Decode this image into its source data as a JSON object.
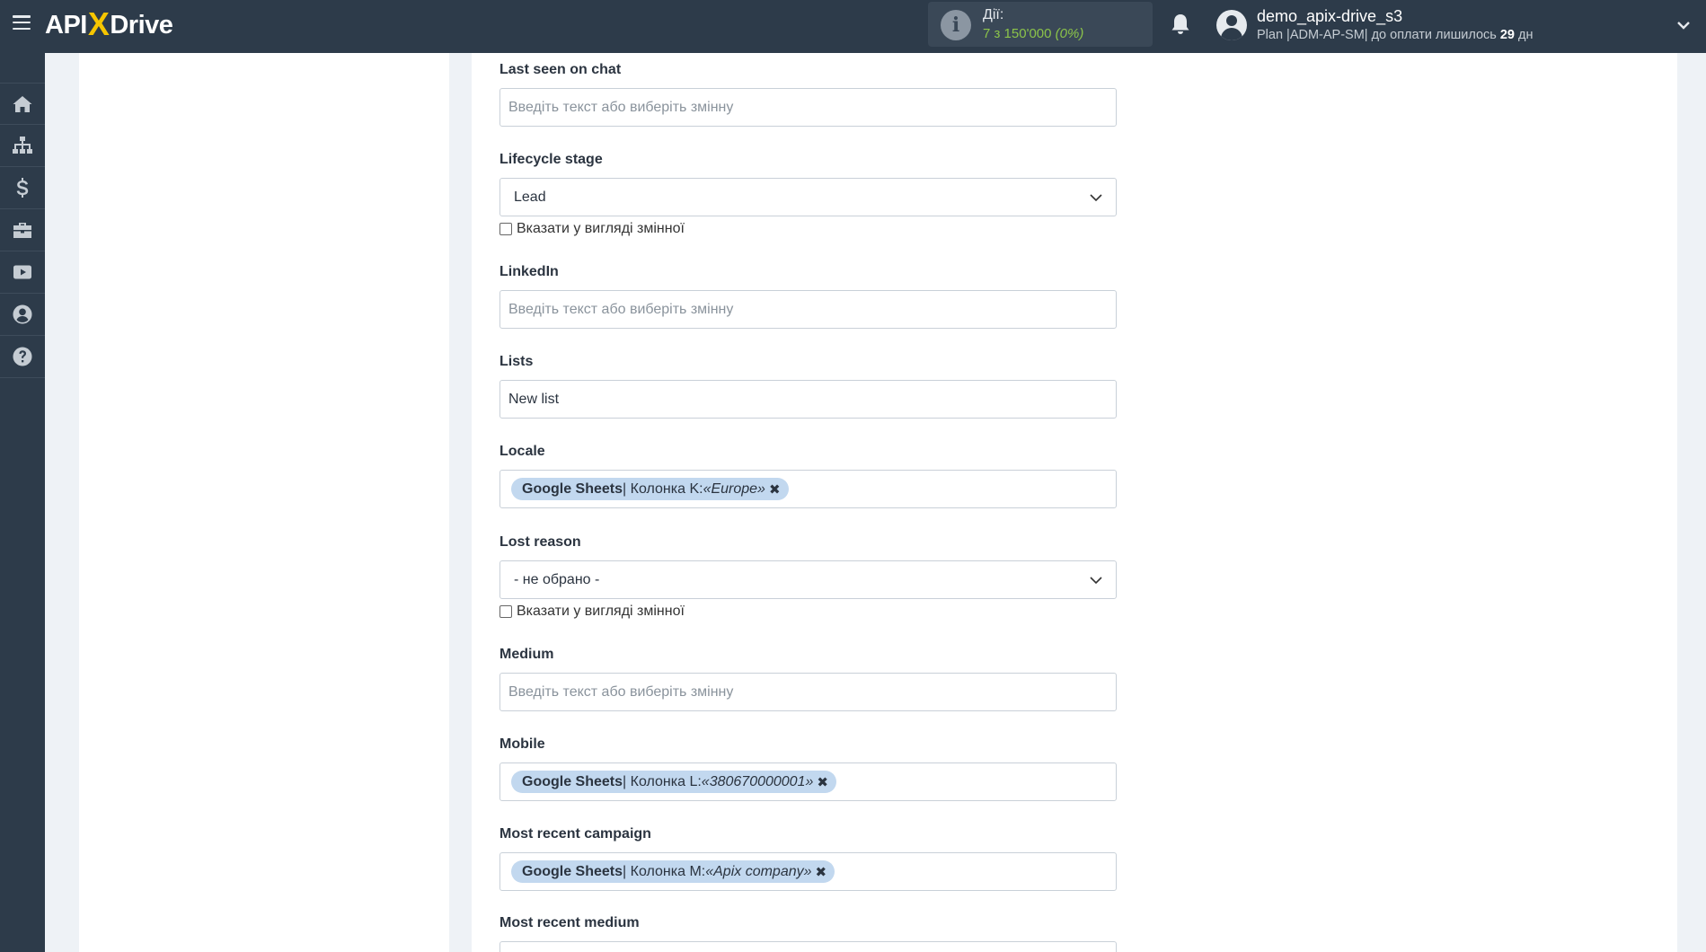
{
  "header": {
    "logo": {
      "api": "APIX",
      "x": "X",
      "drive": "Drive"
    },
    "actions": {
      "label": "Дії:",
      "count": "7 з 150'000",
      "percent": "(0%)"
    },
    "user": {
      "name": "demo_apix-drive_s3",
      "plan_prefix": "Plan |ADM-AP-SM| до оплати лишилось ",
      "days": "29",
      "days_suffix": " дн"
    }
  },
  "sidebar": {
    "items": [
      {
        "name": "home-icon"
      },
      {
        "name": "sitemap-icon"
      },
      {
        "name": "dollar-icon"
      },
      {
        "name": "briefcase-icon"
      },
      {
        "name": "youtube-icon"
      },
      {
        "name": "user-circle-icon"
      },
      {
        "name": "help-icon"
      }
    ]
  },
  "form": {
    "placeholder": "Введіть текст або виберіть змінну",
    "checkbox_label": "Вказати у вигляді змінної",
    "fields": {
      "last_seen_on_chat": {
        "label": "Last seen on chat"
      },
      "lifecycle_stage": {
        "label": "Lifecycle stage",
        "value": "Lead"
      },
      "linkedin": {
        "label": "LinkedIn"
      },
      "lists": {
        "label": "Lists",
        "value": "New list"
      },
      "locale": {
        "label": "Locale",
        "tag": {
          "source": "Google Sheets",
          "column": " | Колонка K: ",
          "value": "«Europe»"
        }
      },
      "lost_reason": {
        "label": "Lost reason",
        "value": "- не обрано -"
      },
      "medium": {
        "label": "Medium"
      },
      "mobile": {
        "label": "Mobile",
        "tag": {
          "source": "Google Sheets",
          "column": " | Колонка L: ",
          "value": "«380670000001»"
        }
      },
      "most_recent_campaign": {
        "label": "Most recent campaign",
        "tag": {
          "source": "Google Sheets",
          "column": " | Колонка M: ",
          "value": "«Apix company»"
        }
      },
      "most_recent_medium": {
        "label": "Most recent medium"
      }
    }
  },
  "colors": {
    "topbar": "#2d3b4a",
    "accent_yellow": "#f7c600",
    "actions_green": "#8bc34a",
    "tag_bg": "#c2d8ef"
  }
}
